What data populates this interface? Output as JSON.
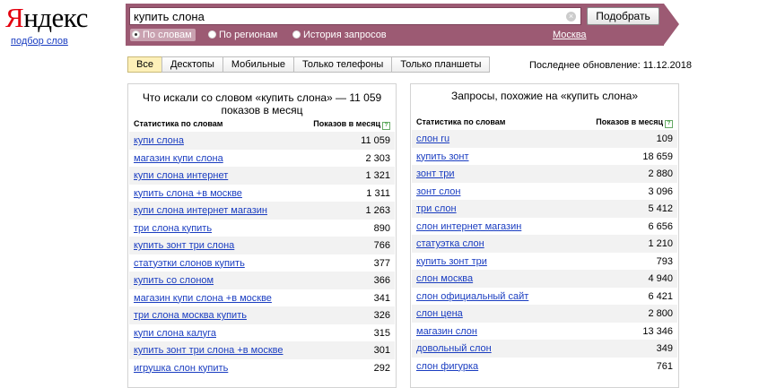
{
  "logo": {
    "first_letter": "Я",
    "rest": "ндекс"
  },
  "logo_sublink": "подбор слов",
  "search": {
    "value": "купить слона",
    "clear_glyph": "×",
    "button": "Подобрать",
    "modes": [
      "По словам",
      "По регионам",
      "История запросов"
    ],
    "selected_mode": "По словам",
    "region": "Москва"
  },
  "tabs": [
    "Все",
    "Десктопы",
    "Мобильные",
    "Только телефоны",
    "Только планшеты"
  ],
  "active_tab": "Все",
  "last_update": "Последнее обновление: 11.12.2018",
  "left_panel": {
    "title": "Что искали со словом «купить слона» — 11 059 показов в месяц",
    "col_phrase": "Статистика по словам",
    "col_count": "Показов в месяц",
    "rows": [
      {
        "phrase": "купи слона",
        "count": "11 059"
      },
      {
        "phrase": "магазин купи слона",
        "count": "2 303"
      },
      {
        "phrase": "купи слона интернет",
        "count": "1 321"
      },
      {
        "phrase": "купить слона +в москве",
        "count": "1 311"
      },
      {
        "phrase": "купи слона интернет магазин",
        "count": "1 263"
      },
      {
        "phrase": "три слона купить",
        "count": "890"
      },
      {
        "phrase": "купить зонт три слона",
        "count": "766"
      },
      {
        "phrase": "статуэтки слонов купить",
        "count": "377"
      },
      {
        "phrase": "купить со слоном",
        "count": "366"
      },
      {
        "phrase": "магазин купи слона +в москве",
        "count": "341"
      },
      {
        "phrase": "три слона москва купить",
        "count": "326"
      },
      {
        "phrase": "купи слона калуга",
        "count": "315"
      },
      {
        "phrase": "купить зонт три слона +в москве",
        "count": "301"
      },
      {
        "phrase": "игрушка слон купить",
        "count": "292"
      }
    ]
  },
  "right_panel": {
    "title": "Запросы, похожие на «купить слона»",
    "col_phrase": "Статистика по словам",
    "col_count": "Показов в месяц",
    "rows": [
      {
        "phrase": "слон ru",
        "count": "109"
      },
      {
        "phrase": "купить зонт",
        "count": "18 659"
      },
      {
        "phrase": "зонт три",
        "count": "2 880"
      },
      {
        "phrase": "зонт слон",
        "count": "3 096"
      },
      {
        "phrase": "три слон",
        "count": "5 412"
      },
      {
        "phrase": "слон интернет магазин",
        "count": "6 656"
      },
      {
        "phrase": "статуэтка слон",
        "count": "1 210"
      },
      {
        "phrase": "купить зонт три",
        "count": "793"
      },
      {
        "phrase": "слон москва",
        "count": "4 940"
      },
      {
        "phrase": "слон официальный сайт",
        "count": "6 421"
      },
      {
        "phrase": "слон цена",
        "count": "2 800"
      },
      {
        "phrase": "магазин слон",
        "count": "13 346"
      },
      {
        "phrase": "довольный слон",
        "count": "349"
      },
      {
        "phrase": "слон фигурка",
        "count": "761"
      }
    ]
  },
  "help_glyph": "?",
  "colors": {
    "brand_band": "#9c5a73",
    "link": "#1a3dc1",
    "logo_red": "#e3000f",
    "active_tab": "#fdf0b8"
  }
}
